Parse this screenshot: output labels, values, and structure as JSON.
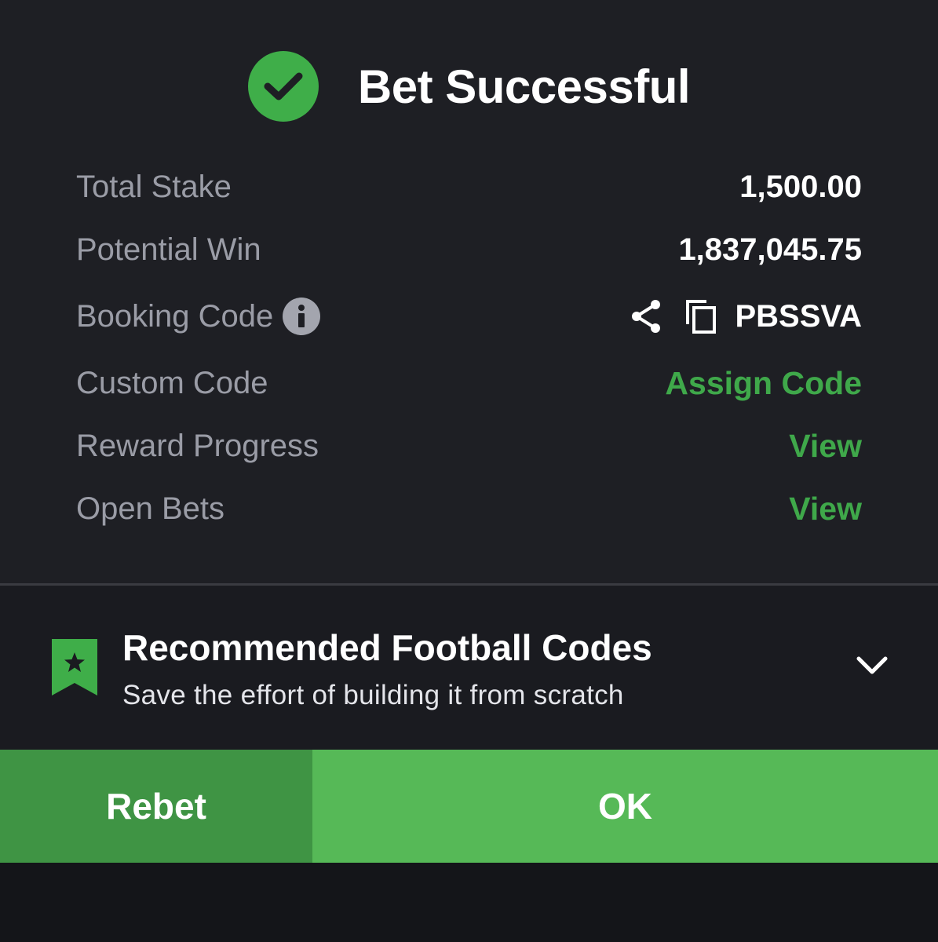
{
  "header": {
    "title": "Bet Successful",
    "icon": "check-circle-icon"
  },
  "details": {
    "total_stake_label": "Total Stake",
    "total_stake_value": "1,500.00",
    "potential_win_label": "Potential Win",
    "potential_win_value": "1,837,045.75",
    "booking_code_label": "Booking Code",
    "booking_code_value": "PBSSVA",
    "custom_code_label": "Custom Code",
    "custom_code_action": "Assign Code",
    "reward_progress_label": "Reward Progress",
    "reward_progress_action": "View",
    "open_bets_label": "Open Bets",
    "open_bets_action": "View"
  },
  "recommend": {
    "title": "Recommended Football Codes",
    "subtitle": "Save the effort of building it from scratch"
  },
  "buttons": {
    "rebet": "Rebet",
    "ok": "OK"
  },
  "colors": {
    "accent_green": "#3fa84a",
    "ok_button": "#56b957",
    "rebet_button": "#3f9444",
    "background": "#1e1f24"
  }
}
